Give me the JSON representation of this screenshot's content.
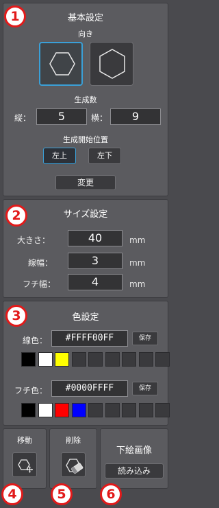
{
  "badges": [
    "1",
    "2",
    "3",
    "4",
    "5",
    "6"
  ],
  "basic_settings": {
    "title": "基本設定",
    "orientation_label": "向き",
    "orientation_options": [
      "hexagon-pointy-horizontal-icon",
      "hexagon-pointy-vertical-icon"
    ],
    "orientation_selected": 0,
    "gen_count_label": "生成数",
    "rows_label": "縦：",
    "rows_value": "5",
    "cols_label": "横：",
    "cols_value": "9",
    "start_pos_label": "生成開始位置",
    "start_top_left": "左上",
    "start_bottom_left": "左下",
    "start_selected": "左上",
    "change_button": "変更"
  },
  "size_settings": {
    "title": "サイズ設定",
    "size_label": "大きさ：",
    "size_value": "40",
    "line_width_label": "線幅：",
    "line_width_value": "3",
    "border_width_label": "フチ幅：",
    "border_width_value": "4",
    "unit": "mm"
  },
  "color_settings": {
    "title": "色設定",
    "line_color_label": "線色：",
    "line_color_value": "#FFFF00FF",
    "border_color_label": "フチ色：",
    "border_color_value": "#0000FFFF",
    "save_label": "保存",
    "line_swatches": [
      "#000000",
      "#ffffff",
      "#ffff00",
      "#3a3a3d",
      "#3a3a3d",
      "#3a3a3d",
      "#3a3a3d",
      "#3a3a3d",
      "#3a3a3d"
    ],
    "border_swatches": [
      "#000000",
      "#ffffff",
      "#ff0000",
      "#0000ff",
      "#3a3a3d",
      "#3a3a3d",
      "#3a3a3d",
      "#3a3a3d",
      "#3a3a3d"
    ]
  },
  "tools": {
    "move_label": "移動",
    "move_icon": "move-hexagon-icon",
    "delete_label": "削除",
    "delete_icon": "eraser-icon",
    "underlay_label": "下絵画像",
    "load_button": "読み込み"
  },
  "colors": {
    "accent": "#3aa0d8",
    "badge": "#e21a1a"
  }
}
